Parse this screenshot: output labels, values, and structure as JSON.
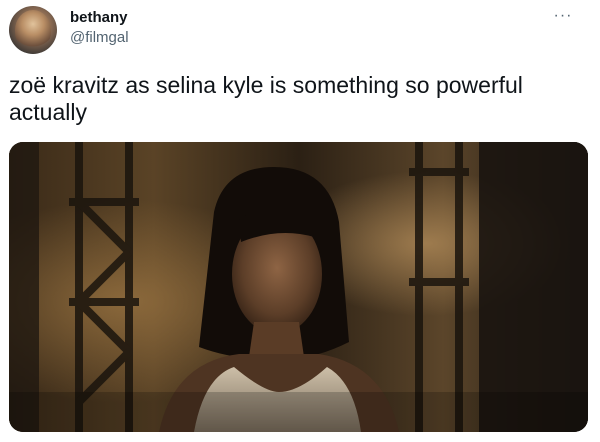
{
  "tweet": {
    "display_name": "bethany",
    "handle": "@filmgal",
    "more_icon": "more-horizontal-icon",
    "more_glyph": "···",
    "text": "zoë kravitz as selina kyle is something so powerful actually"
  },
  "colors": {
    "text_primary": "#0f1419",
    "text_secondary": "#536471",
    "background": "#ffffff"
  }
}
